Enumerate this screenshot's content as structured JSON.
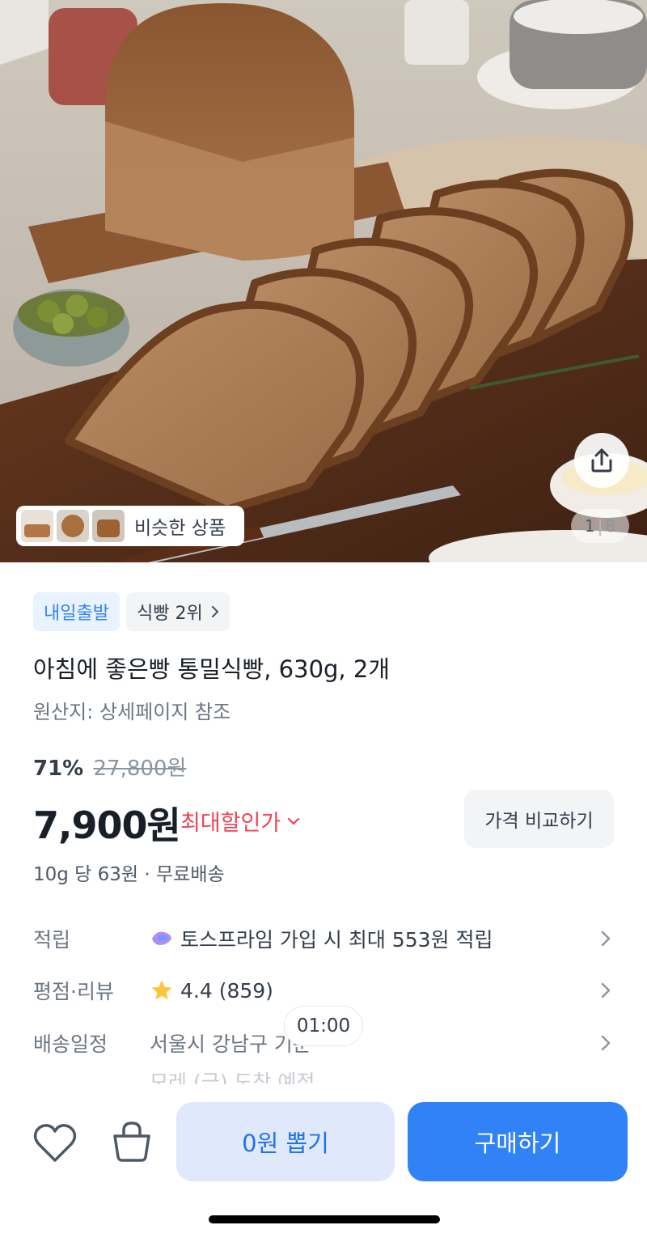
{
  "gallery": {
    "current": "1",
    "total": "8",
    "similar_label": "비슷한 상품",
    "share_icon": "share-icon"
  },
  "tags": {
    "delivery": "내일출발",
    "rank": "식빵 2위"
  },
  "product": {
    "title": "아침에 좋은빵 통밀식빵, 630g, 2개",
    "origin": "원산지: 상세페이지 참조"
  },
  "pricing": {
    "discount_rate": "71%",
    "original_price": "27,800원",
    "price": "7,900원",
    "max_discount_label": "최대할인가",
    "compare_label": "가격 비교하기",
    "unit_info": "10g 당 63원 · 무료배송"
  },
  "details": {
    "points_key": "적립",
    "points_value": "토스프라임 가입 시 최대 553원 적립",
    "rating_key": "평점·리뷰",
    "rating_value": "4.4 (859)",
    "delivery_key": "배송일정",
    "delivery_value": "서울시 강남구 기준",
    "delivery_eta": "모레 (금) 도착 예정"
  },
  "timer": "01:00",
  "actions": {
    "zero_won_label": "0원 뽑기",
    "buy_label": "구매하기"
  },
  "colors": {
    "accent": "#3182f6",
    "sale_red": "#f04452",
    "star": "#ffc342"
  }
}
